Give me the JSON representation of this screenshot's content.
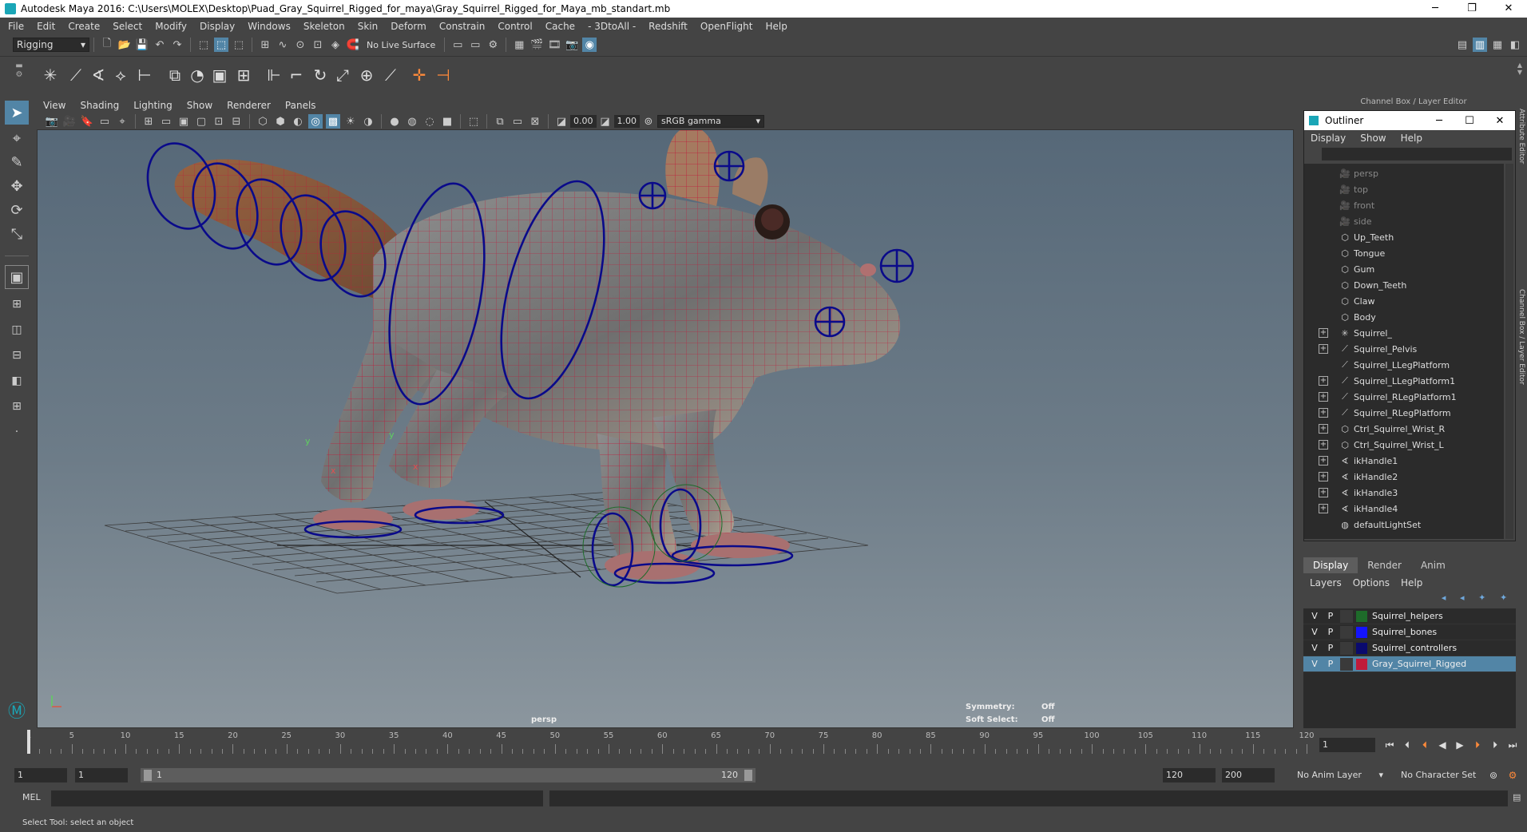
{
  "window": {
    "title": "Autodesk Maya 2016: C:\\Users\\MOLEX\\Desktop\\Puad_Gray_Squirrel_Rigged_for_maya\\Gray_Squirrel_Rigged_for_Maya_mb_standart.mb",
    "minimize": "─",
    "restore": "❐",
    "close": "✕"
  },
  "menubar": [
    "File",
    "Edit",
    "Create",
    "Select",
    "Modify",
    "Display",
    "Windows",
    "Skeleton",
    "Skin",
    "Deform",
    "Constrain",
    "Control",
    "Cache",
    "- 3DtoAll -",
    "Redshift",
    "OpenFlight",
    "Help"
  ],
  "statusline": {
    "menuset": "Rigging",
    "live_surface": "No Live Surface"
  },
  "viewport": {
    "menu": [
      "View",
      "Shading",
      "Lighting",
      "Show",
      "Renderer",
      "Panels"
    ],
    "field_near": "0.00",
    "field_far": "1.00",
    "colorspace": "sRGB gamma",
    "camera_label": "persp",
    "hud": {
      "symmetry_label": "Symmetry:",
      "symmetry_value": "Off",
      "softselect_label": "Soft Select:",
      "softselect_value": "Off"
    },
    "axis": {
      "x": "x",
      "y": "y",
      "z": "z"
    }
  },
  "right_panel": {
    "header": "Channel Box / Layer Editor",
    "side_tab_attr": "Attribute Editor",
    "side_tab_cb": "Channel Box / Layer Editor"
  },
  "outliner": {
    "title": "Outliner",
    "menu": [
      "Display",
      "Show",
      "Help"
    ],
    "items": [
      {
        "label": "persp",
        "icon": "camera-icon",
        "expand": false,
        "dim": true
      },
      {
        "label": "top",
        "icon": "camera-icon",
        "expand": false,
        "dim": true
      },
      {
        "label": "front",
        "icon": "camera-icon",
        "expand": false,
        "dim": true
      },
      {
        "label": "side",
        "icon": "camera-icon",
        "expand": false,
        "dim": true
      },
      {
        "label": "Up_Teeth",
        "icon": "mesh-icon",
        "expand": false,
        "dim": false
      },
      {
        "label": "Tongue",
        "icon": "mesh-icon",
        "expand": false,
        "dim": false
      },
      {
        "label": "Gum",
        "icon": "mesh-icon",
        "expand": false,
        "dim": false
      },
      {
        "label": "Down_Teeth",
        "icon": "mesh-icon",
        "expand": false,
        "dim": false
      },
      {
        "label": "Claw",
        "icon": "mesh-icon",
        "expand": false,
        "dim": false
      },
      {
        "label": "Body",
        "icon": "mesh-icon",
        "expand": false,
        "dim": false
      },
      {
        "label": "Squirrel_",
        "icon": "joint-icon",
        "expand": true,
        "dim": false
      },
      {
        "label": "Squirrel_Pelvis",
        "icon": "curve-icon",
        "expand": true,
        "dim": false
      },
      {
        "label": "Squirrel_LLegPlatform",
        "icon": "curve-icon",
        "expand": false,
        "dim": false
      },
      {
        "label": "Squirrel_LLegPlatform1",
        "icon": "curve-icon",
        "expand": true,
        "dim": false
      },
      {
        "label": "Squirrel_RLegPlatform1",
        "icon": "curve-icon",
        "expand": true,
        "dim": false
      },
      {
        "label": "Squirrel_RLegPlatform",
        "icon": "curve-icon",
        "expand": true,
        "dim": false
      },
      {
        "label": "Ctrl_Squirrel_Wrist_R",
        "icon": "mesh-icon",
        "expand": true,
        "dim": false
      },
      {
        "label": "Ctrl_Squirrel_Wrist_L",
        "icon": "mesh-icon",
        "expand": true,
        "dim": false
      },
      {
        "label": "ikHandle1",
        "icon": "ik-icon",
        "expand": true,
        "dim": false
      },
      {
        "label": "ikHandle2",
        "icon": "ik-icon",
        "expand": true,
        "dim": false
      },
      {
        "label": "ikHandle3",
        "icon": "ik-icon",
        "expand": true,
        "dim": false
      },
      {
        "label": "ikHandle4",
        "icon": "ik-icon",
        "expand": true,
        "dim": false
      },
      {
        "label": "defaultLightSet",
        "icon": "set-icon",
        "expand": false,
        "dim": false
      }
    ]
  },
  "layer_editor": {
    "tabs": [
      "Display",
      "Render",
      "Anim"
    ],
    "menu": [
      "Layers",
      "Options",
      "Help"
    ],
    "layers": [
      {
        "v": "V",
        "p": "P",
        "color": "#1e6b2a",
        "name": "Squirrel_helpers",
        "selected": false
      },
      {
        "v": "V",
        "p": "P",
        "color": "#1414ff",
        "name": "Squirrel_bones",
        "selected": false
      },
      {
        "v": "V",
        "p": "P",
        "color": "#0a0a6e",
        "name": "Squirrel_controllers",
        "selected": false
      },
      {
        "v": "V",
        "p": "P",
        "color": "#c01a3a",
        "name": "Gray_Squirrel_Rigged",
        "selected": true
      }
    ]
  },
  "timeline": {
    "ticks": [
      "1",
      "5",
      "10",
      "15",
      "20",
      "25",
      "30",
      "35",
      "40",
      "45",
      "50",
      "55",
      "60",
      "65",
      "70",
      "75",
      "80",
      "85",
      "90",
      "95",
      "100",
      "105",
      "110",
      "115",
      "120"
    ],
    "current_frame": "1"
  },
  "range": {
    "start": "1",
    "playback_start": "1",
    "slider_start": "1",
    "slider_end": "120",
    "playback_end": "120",
    "end": "200",
    "anim_layer": "No Anim Layer",
    "character_set": "No Character Set"
  },
  "command_line": {
    "label": "MEL"
  },
  "help_line": "Select Tool: select an object",
  "colors": {
    "accent": "#5285a6",
    "wire": "#c01a3a",
    "controller": "#0a0a8a"
  }
}
